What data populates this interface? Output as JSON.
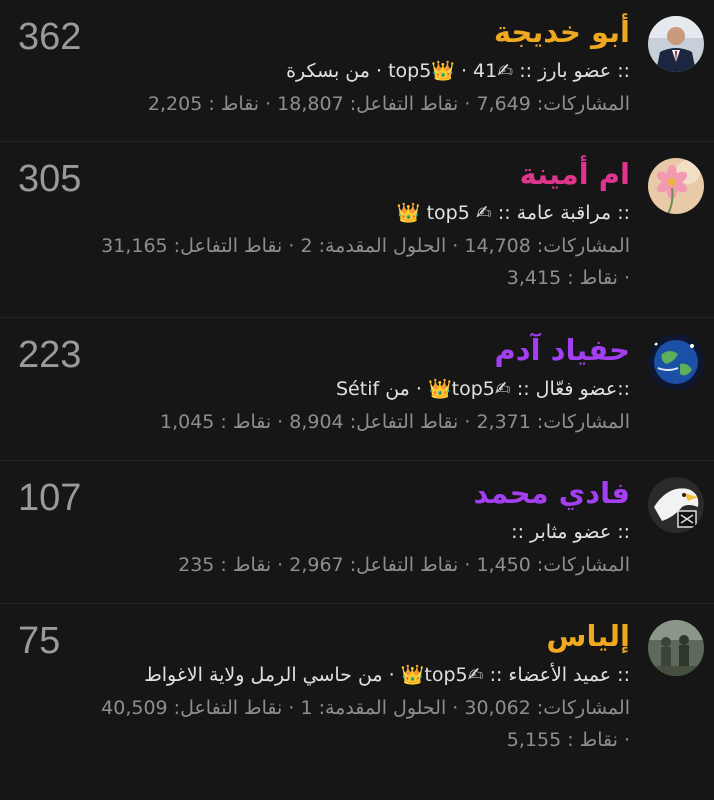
{
  "members": [
    {
      "score": "362",
      "username": "أبو خديجة",
      "name_color": "#f0a820",
      "avatar": "man-in-suit-avatar",
      "rank_line": ":: عضو بارز :: ✍top5👑 · 41 · من بسكرة",
      "stats_line": "المشاركات: 7,649 · نقاط التفاعل: 18,807 · نقاط : 2,205"
    },
    {
      "score": "305",
      "username": "ام أمينة",
      "name_color": "#e0358f",
      "avatar": "pink-flower-avatar",
      "rank_line": ":: مراقبة عامة :: ✍ top5 👑",
      "stats_line": "المشاركات: 14,708 · الحلول المقدمة: 2 · نقاط التفاعل: 31,165 · نقاط : 3,415"
    },
    {
      "score": "223",
      "username": "حفياد آدم",
      "name_color": "#a33ff0",
      "avatar": "earth-globe-avatar",
      "rank_line": "::عضو فعّال :: ✍top5👑 · من Sétif",
      "stats_line": "المشاركات: 2,371 · نقاط التفاعل: 8,904 · نقاط : 1,045"
    },
    {
      "score": "107",
      "username": "فادي محمد",
      "name_color": "#a33ff0",
      "avatar": "eagle-avatar",
      "rank_line": ":: عضو مثابر ::",
      "stats_line": "المشاركات: 1,450 · نقاط التفاعل: 2,967 · نقاط : 235"
    },
    {
      "score": "75",
      "username": "إلياس",
      "name_color": "#f0a820",
      "avatar": "soldiers-avatar",
      "rank_line": ":: عميد الأعضاء :: ✍top5👑 · من حاسي الرمل ولاية الاغواط",
      "stats_line": "المشاركات: 30,062 · الحلول المقدمة: 1 · نقاط التفاعل: 40,509 · نقاط : 5,155"
    }
  ]
}
